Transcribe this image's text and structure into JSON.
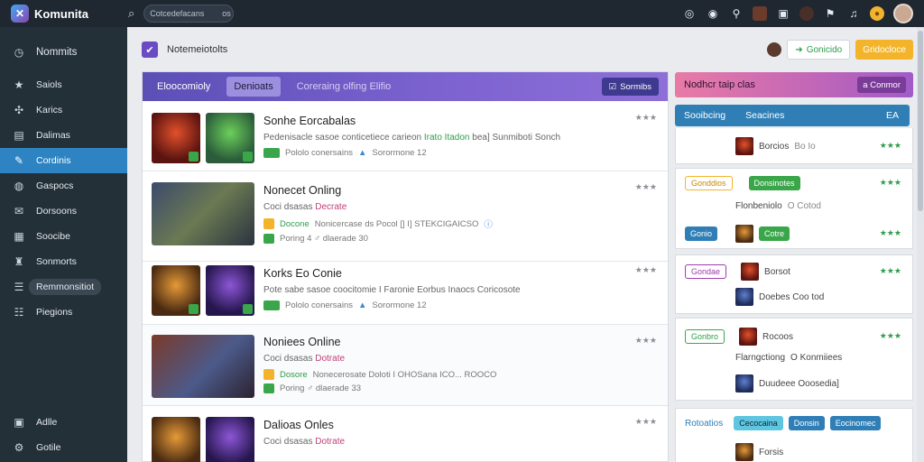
{
  "app": {
    "name": "Komunita",
    "search_value": "Cotcedefacans",
    "search_hint": "os"
  },
  "sidebar": {
    "items": [
      {
        "label": "Nommits",
        "icon": "clock-icon"
      },
      {
        "label": "Saiols",
        "icon": "star-icon"
      },
      {
        "label": "Karics",
        "icon": "puzzle-icon"
      },
      {
        "label": "Dalimas",
        "icon": "chat-icon"
      },
      {
        "label": "Cordinis",
        "icon": "pen-icon",
        "active": true
      },
      {
        "label": "Gaspocs",
        "icon": "globe-icon"
      },
      {
        "label": "Dorsoons",
        "icon": "mail-icon"
      },
      {
        "label": "Soocibe",
        "icon": "calendar-icon"
      },
      {
        "label": "Sonmorts",
        "icon": "trophy-icon"
      },
      {
        "label": "Remmonsitiot",
        "icon": "list-icon"
      },
      {
        "label": "Piegions",
        "icon": "grid-icon"
      }
    ],
    "bottom": [
      {
        "label": "Adlle",
        "icon": "box-icon"
      },
      {
        "label": "Gotile",
        "icon": "gear-icon"
      }
    ]
  },
  "main": {
    "title": "Notemeiotolts",
    "btn_green": "Gonicido",
    "btn_yellow": "Gridocloce"
  },
  "feed": {
    "tabs": [
      "Eloocomioly",
      "Denioats",
      "Coreraing olfing Elifio"
    ],
    "action": "Sormibs",
    "posts": [
      {
        "title": "Sonhe Eorcabalas",
        "desc_a": "Pedenisacle sasoe conticetiece carieon",
        "desc_b": "Irato Itadon",
        "desc_c": "bea] Sunmiboti Sonch",
        "meta_a": "Pololo conersains",
        "meta_b": "Sorormone 12",
        "rating": "★★★"
      },
      {
        "title": "Nonecet Onling",
        "sub_a": "Coci dsasas",
        "sub_b": "Decrate",
        "meta_a": "Docone",
        "meta_b": "Nonicercase ds Pocol [] I] STEKCIGAICSO",
        "meta_c": "Poring 4 ♂ dlaerade 30",
        "rating": "★★★"
      },
      {
        "title": "Korks Eo Conie",
        "desc_a": "Pote sabe sasoe coocitomie I Faronie Eorbus Inaocs Coricosote",
        "meta_a": "Pololo conersains",
        "meta_b": "Sorormone 12",
        "rating": "★★★"
      },
      {
        "title": "Noniees Online",
        "sub_a": "Coci dsasas",
        "sub_b": "Dotrate",
        "meta_a": "Dosore",
        "meta_b": "Nonecerosate Doloti I OHOSana ICO... ROOCO",
        "meta_c": "Poring ♂ dlaerade 33",
        "rating": "★★★"
      },
      {
        "title": "Dalioas Onles",
        "sub_a": "Coci dsasas",
        "sub_b": "Dotrate",
        "rating": "★★★"
      }
    ]
  },
  "right": {
    "header": "Nodhcr taip clas",
    "header_btn": "a Conmor",
    "tabs": [
      "Sooibcing",
      "Seacines"
    ],
    "tab_right": "EA",
    "rows": [
      {
        "label": "Borcios",
        "extra": "Bo Io"
      },
      {
        "label": "Flonbeniolo",
        "extra": "O Cotod"
      },
      {
        "label": "Borsot",
        "extra": ""
      },
      {
        "label": "Doebes Coo tod",
        "extra": ""
      },
      {
        "label": "Rocoos",
        "extra": ""
      },
      {
        "label": "Flarngctiong",
        "extra": "O Konmiiees"
      },
      {
        "label": "Duudeee Ooosedia]",
        "extra": ""
      },
      {
        "label": "Forsis",
        "extra": ""
      }
    ],
    "btn_yellow": "Gonddios",
    "btn_green": "Donsinotes",
    "btn_blue": "Gonio",
    "btn_purple": "Gondae",
    "btn_green2": "Gonbro",
    "btn_green3": "Cotre",
    "bottom_label": "Rotoatios",
    "bottom_btns": [
      "Cecocaina",
      "Donsin",
      "Eocinomec"
    ],
    "rating": "★★★"
  }
}
